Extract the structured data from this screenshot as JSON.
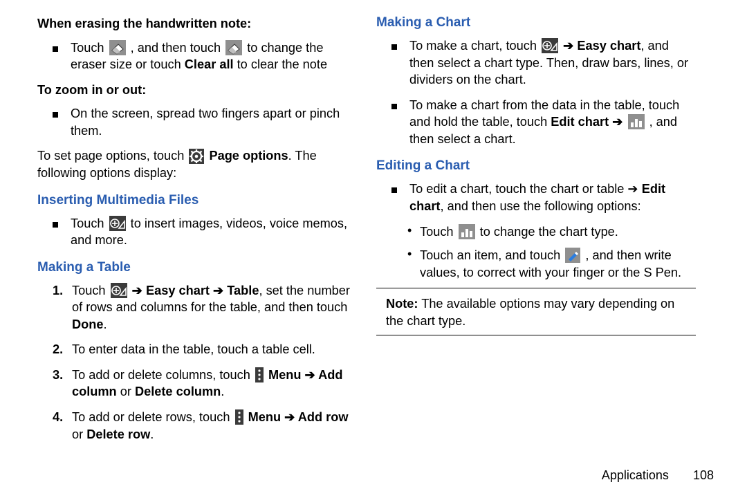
{
  "left": {
    "h_erase": "When erasing the handwritten note:",
    "erase_item": {
      "pre1": "Touch ",
      "mid": ", and then touch ",
      "post": " to change the eraser size or touch ",
      "clearall": "Clear all",
      "tail": " to clear the note"
    },
    "h_zoom": "To zoom in or out:",
    "zoom_item": "On the screen, spread two fingers apart or pinch them.",
    "page_options": {
      "pre": "To set page options, touch ",
      "label": " Page options",
      "post": ". The following options display:"
    },
    "h_multimedia": "Inserting Multimedia Files",
    "mm_item": {
      "pre": "Touch ",
      "post": " to insert images, videos, voice memos, and more."
    },
    "h_table": "Making a Table",
    "tbl1": {
      "num": "1.",
      "pre": "Touch ",
      "arrow1": " ➔ ",
      "easy": "Easy chart ➔ Table",
      "post": ", set the number of rows and columns for the table, and then touch ",
      "done": "Done",
      "end": "."
    },
    "tbl2": {
      "num": "2.",
      "text": "To enter data in the table, touch a table cell."
    },
    "tbl3": {
      "num": "3.",
      "pre": "To add or delete columns, touch ",
      "menu": " Menu ➔ Add column",
      "or": " or ",
      "del": "Delete column",
      "end": "."
    },
    "tbl4": {
      "num": "4.",
      "pre": "To add or delete rows, touch ",
      "menu": " Menu ➔ Add row",
      "or": " or ",
      "del": "Delete row",
      "end": "."
    }
  },
  "right": {
    "h_makechart": "Making a Chart",
    "mc1": {
      "pre": "To make a chart, touch ",
      "arrow": " ➔ ",
      "easy": "Easy chart",
      "post": ", and then select a chart type. Then, draw bars, lines, or dividers on the chart."
    },
    "mc2": {
      "pre": "To make a chart from the data in the table, touch and hold the table, touch ",
      "editchart": "Edit chart ➔ ",
      "post": ", and then select a chart."
    },
    "h_editchart": "Editing a Chart",
    "ec_lead": {
      "pre": "To edit a chart, touch the chart or table ➔ ",
      "editchart": "Edit chart",
      "post": ", and then use the following options:"
    },
    "ec_sub1": {
      "pre": "Touch ",
      "post": " to change the chart type."
    },
    "ec_sub2": {
      "pre": "Touch an item, and touch ",
      "post": ", and then write values, to correct with your finger or the S Pen."
    },
    "note": {
      "label": "Note:",
      "text": " The available options may vary depending on the chart type."
    }
  },
  "footer": {
    "section": "Applications",
    "page": "108"
  }
}
